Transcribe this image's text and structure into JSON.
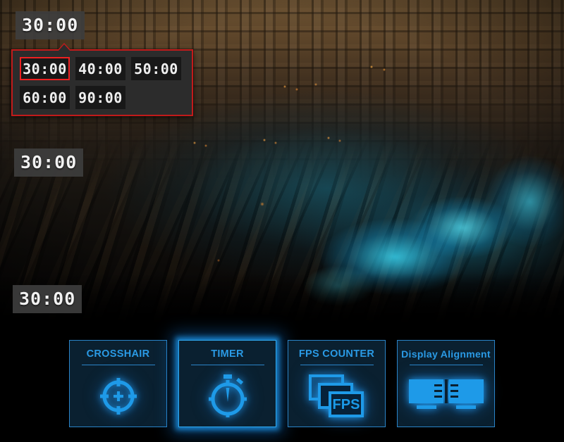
{
  "overlay": {
    "badges": [
      {
        "name": "timer-badge-top",
        "value": "30:00"
      },
      {
        "name": "timer-badge-middle",
        "value": "30:00"
      },
      {
        "name": "timer-badge-bottom",
        "value": "30:00"
      }
    ]
  },
  "timer_popup": {
    "selected_value": "30:00",
    "presets": [
      "30:00",
      "40:00",
      "50:00",
      "60:00",
      "90:00"
    ],
    "border_color": "#c21b1b",
    "selection_color": "#ee2020",
    "background_color": "#2c2c2c",
    "tile_color": "#181818"
  },
  "toolbar": {
    "accent_color": "#2a9ae5",
    "panel_background": "#0a2030",
    "active_glow_color": "#2fa8ef",
    "buttons": [
      {
        "label": "CROSSHAIR",
        "icon": "crosshair-icon",
        "active": false
      },
      {
        "label": "TIMER",
        "icon": "stopwatch-icon",
        "active": true
      },
      {
        "label": "FPS COUNTER",
        "icon": "fps-frames-icon",
        "active": false
      },
      {
        "label": "Display Alignment",
        "icon": "dual-monitor-icon",
        "active": false
      }
    ],
    "fps_icon_text": "FPS"
  }
}
